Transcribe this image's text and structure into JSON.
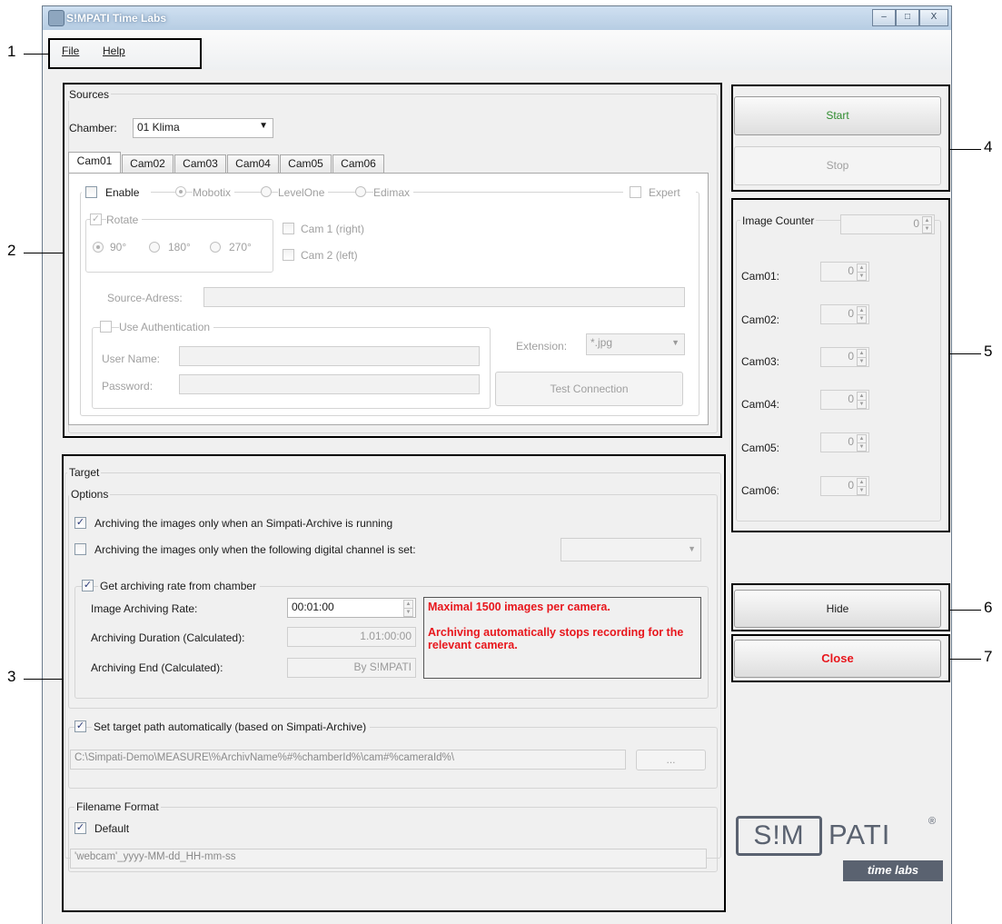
{
  "window": {
    "title": "S!MPATI Time Labs"
  },
  "titlebar_buttons": {
    "minimize": "–",
    "maximize": "□",
    "close": "X"
  },
  "menu": {
    "file": "File",
    "help": "Help"
  },
  "sources": {
    "group_label": "Sources",
    "chamber_label": "Chamber:",
    "chamber_value": "01 Klima",
    "tabs": [
      "Cam01",
      "Cam02",
      "Cam03",
      "Cam04",
      "Cam05",
      "Cam06"
    ],
    "enable_label": "Enable",
    "camera_types": [
      "Mobotix",
      "LevelOne",
      "Edimax"
    ],
    "expert_label": "Expert",
    "rotate_label": "Rotate",
    "rotate_options": [
      "90°",
      "180°",
      "270°"
    ],
    "cam1_label": "Cam 1 (right)",
    "cam2_label": "Cam 2 (left)",
    "source_address_label": "Source-Adress:",
    "use_auth_label": "Use Authentication",
    "username_label": "User Name:",
    "password_label": "Password:",
    "extension_label": "Extension:",
    "extension_value": "*.jpg",
    "test_connection_label": "Test Connection"
  },
  "target": {
    "group_label": "Target",
    "options_label": "Options",
    "archive_running_label": "Archiving the images only when an Simpati-Archive is running",
    "digital_channel_label": "Archiving the images only when the following digital channel is set:",
    "get_rate_label": "Get archiving rate from chamber",
    "image_rate_label": "Image Archiving Rate:",
    "image_rate_value": "00:01:00",
    "duration_label": "Archiving Duration (Calculated):",
    "duration_value": "1.01:00:00",
    "end_label": "Archiving End (Calculated):",
    "end_value": "By S!MPATI",
    "warning_line1": "Maximal  1500 images per camera.",
    "warning_line2": "Archiving automatically stops recording for the relevant camera.",
    "set_path_label": "Set target path automatically (based on Simpati-Archive)",
    "path_value": "C:\\Simpati-Demo\\MEASURE\\%ArchivName%#%chamberId%\\cam#%cameraId%\\",
    "browse_label": "...",
    "filename_group_label": "Filename Format",
    "default_label": "Default",
    "filename_value": "'webcam'_yyyy-MM-dd_HH-mm-ss"
  },
  "controls": {
    "start_label": "Start",
    "stop_label": "Stop",
    "hide_label": "Hide",
    "close_label": "Close"
  },
  "counter": {
    "group_label": "Image Counter",
    "total_value": "0",
    "cams": [
      {
        "label": "Cam01:",
        "value": "0"
      },
      {
        "label": "Cam02:",
        "value": "0"
      },
      {
        "label": "Cam03:",
        "value": "0"
      },
      {
        "label": "Cam04:",
        "value": "0"
      },
      {
        "label": "Cam05:",
        "value": "0"
      },
      {
        "label": "Cam06:",
        "value": "0"
      }
    ]
  },
  "logo": {
    "brand_left": "S!M",
    "brand_right": "PATI",
    "registered": "®",
    "tagline": "time labs"
  },
  "callouts": [
    "1",
    "2",
    "3",
    "4",
    "5",
    "6",
    "7"
  ],
  "colors": {
    "start_text": "#2e8b2e",
    "close_text": "#e8161c",
    "warning_text": "#e8161c"
  }
}
